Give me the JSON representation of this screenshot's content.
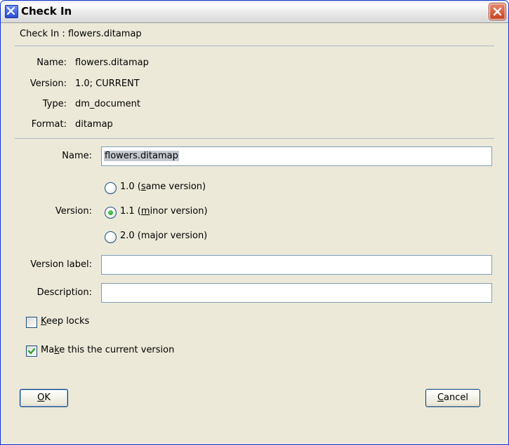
{
  "window": {
    "title": "Check In"
  },
  "heading": "Check In : flowers.ditamap",
  "info": {
    "name_label": "Name:",
    "name_value": "flowers.ditamap",
    "version_label": "Version:",
    "version_value": "1.0; CURRENT",
    "type_label": "Type:",
    "type_value": "dm_document",
    "format_label": "Format:",
    "format_value": "ditamap"
  },
  "form": {
    "name_label": "Name:",
    "name_value": "flowers.ditamap",
    "version_label": "Version:",
    "version_options": [
      {
        "pre": "1.0 (",
        "mnemonic": "s",
        "post": "ame version)",
        "selected": false
      },
      {
        "pre": "1.1 (",
        "mnemonic": "m",
        "post": "inor version)",
        "selected": true
      },
      {
        "pre": "2.0 (ma",
        "mnemonic": "j",
        "post": "or version)",
        "selected": false
      }
    ],
    "version_label_field_label": "Version label:",
    "version_label_value": "",
    "description_label": "Description:",
    "description_value": "",
    "keep_locks": {
      "mnemonic": "K",
      "post": "eep locks",
      "checked": false
    },
    "make_current": {
      "pre": "Ma",
      "mnemonic": "k",
      "post": "e this the current version",
      "checked": true
    }
  },
  "buttons": {
    "ok": {
      "mnemonic": "O",
      "post": "K"
    },
    "cancel": {
      "mnemonic": "C",
      "post": "ancel"
    }
  },
  "icons": {
    "app": "app-x-icon",
    "close": "close-icon",
    "check": "checkmark-icon"
  },
  "colors": {
    "dialog_bg": "#ece9d8",
    "border_blue": "#7f9db9",
    "radio_dot": "#21a121",
    "close_red": "#c84320"
  }
}
